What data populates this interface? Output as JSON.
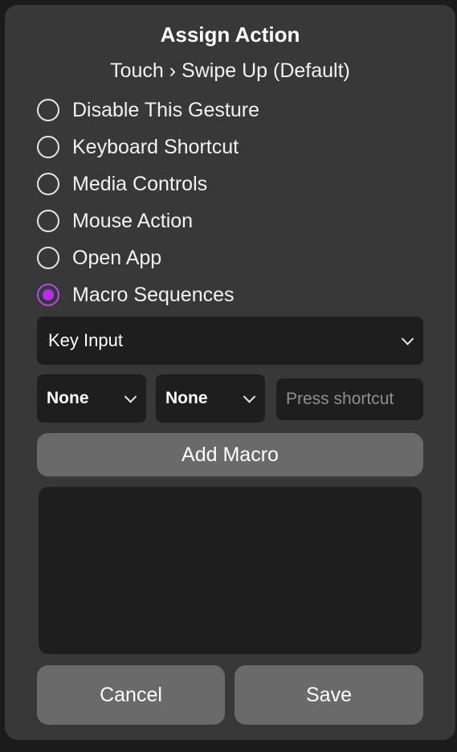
{
  "dialog": {
    "title": "Assign Action",
    "subtitle": "Touch › Swipe Up (Default)"
  },
  "options": [
    {
      "label": "Disable This Gesture",
      "checked": false
    },
    {
      "label": "Keyboard Shortcut",
      "checked": false
    },
    {
      "label": "Media Controls",
      "checked": false
    },
    {
      "label": "Mouse Action",
      "checked": false
    },
    {
      "label": "Open App",
      "checked": false
    },
    {
      "label": "Macro Sequences",
      "checked": true
    }
  ],
  "macro": {
    "action_type": "Key Input",
    "modifier1": "None",
    "modifier2": "None",
    "shortcut_placeholder": "Press shortcut",
    "add_label": "Add Macro"
  },
  "footer": {
    "cancel_label": "Cancel",
    "save_label": "Save"
  },
  "colors": {
    "accent": "#b430f0",
    "dialog_bg": "#383838",
    "field_bg": "#1e1e1e",
    "button_bg": "#6a6a6a"
  },
  "icons": {
    "dropdown": "chevron-down-icon"
  }
}
